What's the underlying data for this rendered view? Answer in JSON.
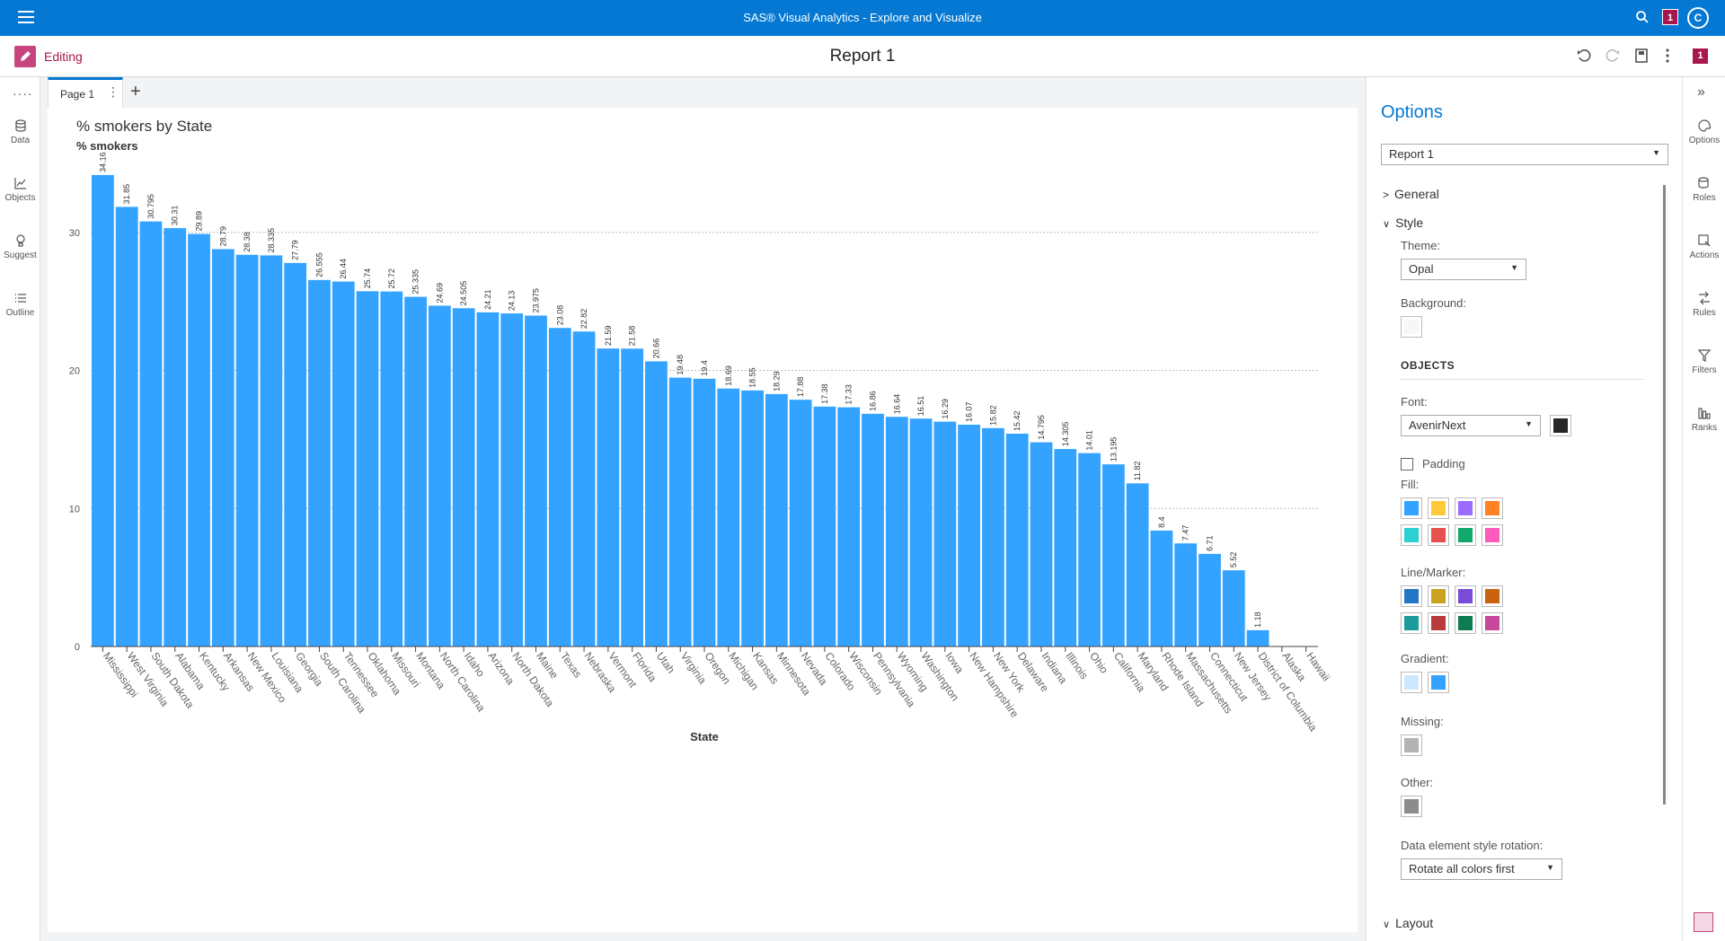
{
  "app": {
    "title": "SAS® Visual Analytics - Explore and Visualize",
    "notif_count": "1",
    "user_initial": "C"
  },
  "toolbar": {
    "editing_label": "Editing",
    "report_title": "Report 1",
    "badge": "1"
  },
  "left_rail": [
    {
      "label": "Data",
      "icon": "database-icon"
    },
    {
      "label": "Objects",
      "icon": "chart-icon"
    },
    {
      "label": "Suggest",
      "icon": "lightbulb-icon"
    },
    {
      "label": "Outline",
      "icon": "list-icon"
    }
  ],
  "page_tabs": [
    {
      "label": "Page 1",
      "active": true
    }
  ],
  "chart_data": {
    "type": "bar",
    "title": "% smokers by State",
    "ylabel": "% smokers",
    "xlabel": "State",
    "ylim": [
      0,
      35
    ],
    "yticks": [
      0,
      10,
      20,
      30
    ],
    "grid": true,
    "color": "#33a3ff",
    "categories": [
      "Mississippi",
      "West Virginia",
      "South Dakota",
      "Alabama",
      "Kentucky",
      "Arkansas",
      "New Mexico",
      "Louisiana",
      "Georgia",
      "South Carolina",
      "Tennessee",
      "Oklahoma",
      "Missouri",
      "Montana",
      "North Carolina",
      "Idaho",
      "Arizona",
      "North Dakota",
      "Maine",
      "Texas",
      "Nebraska",
      "Vermont",
      "Florida",
      "Utah",
      "Virginia",
      "Oregon",
      "Michigan",
      "Kansas",
      "Minnesota",
      "Nevada",
      "Colorado",
      "Wisconsin",
      "Pennsylvania",
      "Wyoming",
      "Washington",
      "Iowa",
      "New Hampshire",
      "New York",
      "Delaware",
      "Indiana",
      "Illinois",
      "Ohio",
      "California",
      "Maryland",
      "Rhode Island",
      "Massachusetts",
      "Connecticut",
      "New Jersey",
      "District of Columbia",
      "Alaska",
      "Hawaii"
    ],
    "values": [
      34.16,
      31.85,
      30.795,
      30.31,
      29.89,
      28.79,
      28.38,
      28.335,
      27.79,
      26.555,
      26.44,
      25.74,
      25.72,
      25.335,
      24.69,
      24.505,
      24.21,
      24.13,
      23.975,
      23.08,
      22.82,
      21.59,
      21.58,
      20.66,
      19.48,
      19.4,
      18.69,
      18.55,
      18.29,
      17.88,
      17.38,
      17.33,
      16.86,
      16.64,
      16.51,
      16.29,
      16.07,
      15.82,
      15.42,
      14.795,
      14.305,
      14.01,
      13.195,
      11.82,
      8.4,
      7.47,
      6.71,
      5.52,
      1.18,
      null,
      null
    ],
    "data_labels": [
      "34.16",
      "31.85",
      "30.795",
      "30.31",
      "29.89",
      "28.79",
      "28.38",
      "28.335",
      "27.79",
      "26.555",
      "26.44",
      "25.74",
      "25.72",
      "25.335",
      "24.69",
      "24.505",
      "24.21",
      "24.13",
      "23.975",
      "23.08",
      "22.82",
      "21.59",
      "21.58",
      "20.66",
      "19.48",
      "19.4",
      "18.69",
      "18.55",
      "18.29",
      "17.88",
      "17.38",
      "17.33",
      "16.86",
      "16.64",
      "16.51",
      "16.29",
      "16.07",
      "15.82",
      "15.42",
      "14.795",
      "14.305",
      "14.01",
      "13.195",
      "11.82",
      "8.4",
      "7.47",
      "6.71",
      "5.52",
      "1.18",
      "",
      ""
    ]
  },
  "options": {
    "title": "Options",
    "object_select": "Report 1",
    "general_label": "General",
    "style_label": "Style",
    "theme_label": "Theme:",
    "theme_value": "Opal",
    "background_label": "Background:",
    "objects_label": "OBJECTS",
    "font_label": "Font:",
    "font_value": "AvenirNext",
    "padding_label": "Padding",
    "fill_label": "Fill:",
    "fill_colors": [
      "#33a3ff",
      "#ffca39",
      "#9c6bff",
      "#ff8224",
      "#2ad1d1",
      "#e5514e",
      "#13a86b",
      "#ff5bbc"
    ],
    "line_label": "Line/Marker:",
    "line_colors": [
      "#2277c4",
      "#c9a21f",
      "#7a4bd6",
      "#c8620f",
      "#1d9b9b",
      "#b83a3a",
      "#0f7b50",
      "#c7479a"
    ],
    "gradient_label": "Gradient:",
    "gradient_colors": [
      "#cde7ff",
      "#33a3ff"
    ],
    "missing_label": "Missing:",
    "missing_color": "#b3b3b3",
    "other_label": "Other:",
    "other_color": "#8c8c8c",
    "rotation_label": "Data element style rotation:",
    "rotation_value": "Rotate all colors first",
    "layout_label": "Layout"
  },
  "right_rail": [
    {
      "label": "Options",
      "icon": "palette-icon"
    },
    {
      "label": "Roles",
      "icon": "roles-icon"
    },
    {
      "label": "Actions",
      "icon": "actions-icon"
    },
    {
      "label": "Rules",
      "icon": "rules-icon"
    },
    {
      "label": "Filters",
      "icon": "filter-icon"
    },
    {
      "label": "Ranks",
      "icon": "ranks-icon"
    }
  ]
}
